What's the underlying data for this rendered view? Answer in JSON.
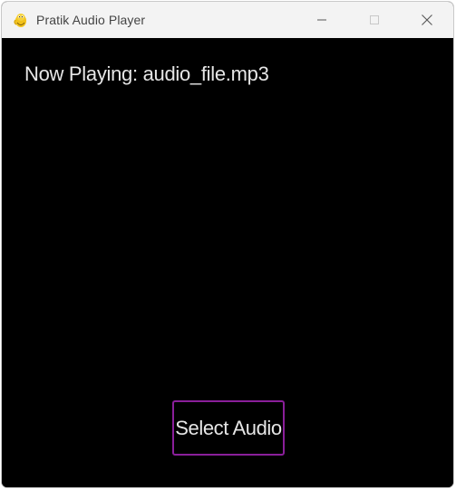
{
  "window": {
    "title": "Pratik Audio Player",
    "app_icon": "python-snake-icon",
    "controls": {
      "minimize_icon": "minimize-icon",
      "maximize_icon": "maximize-icon",
      "close_icon": "close-icon"
    }
  },
  "player": {
    "now_playing_text": "Now Playing: audio_file.mp3",
    "select_button_label": "Select Audio"
  },
  "colors": {
    "background": "#000000",
    "text": "#e6e6e6",
    "button_border": "#8a1f9a",
    "titlebar": "#f3f3f3"
  }
}
